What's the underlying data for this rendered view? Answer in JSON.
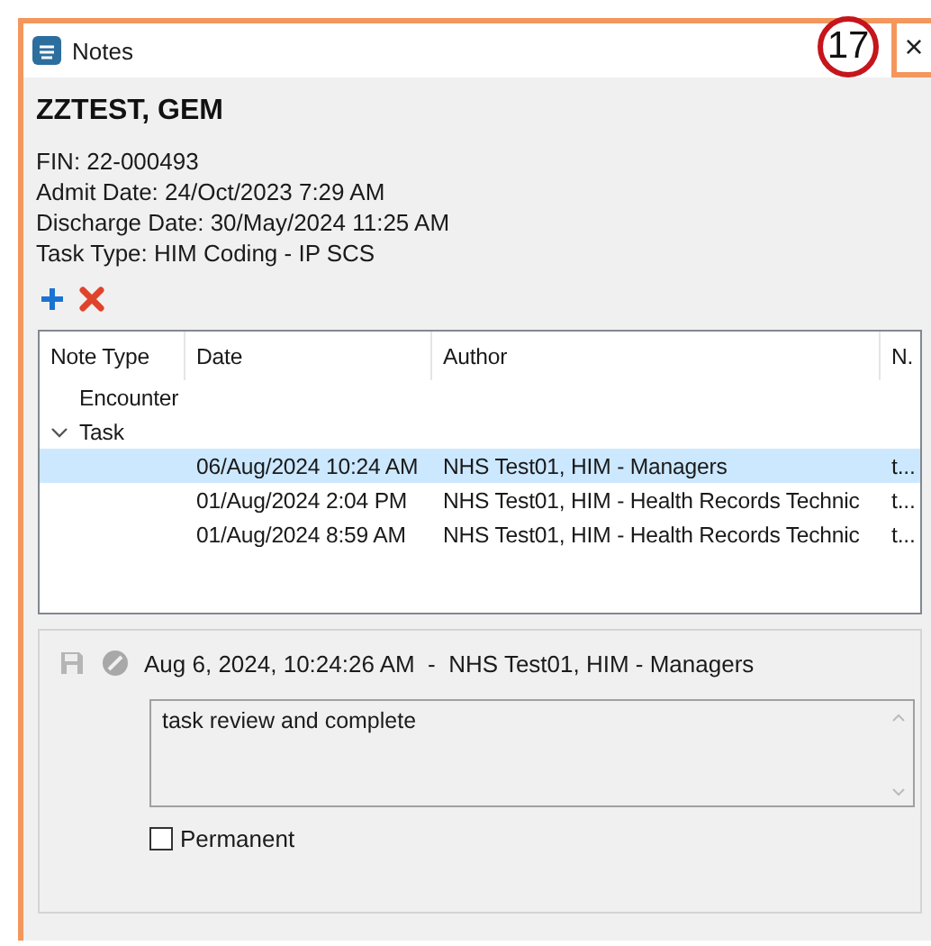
{
  "window": {
    "title": "Notes",
    "close": "×"
  },
  "badge": "17",
  "patient": {
    "name": "ZZTEST, GEM",
    "details": [
      "FIN: 22-000493",
      "Admit Date: 24/Oct/2023 7:29 AM",
      "Discharge Date: 30/May/2024 11:25 AM",
      "Task Type: HIM Coding - IP SCS"
    ]
  },
  "table": {
    "columns": [
      "Note Type",
      "Date",
      "Author",
      "N."
    ],
    "tree": [
      {
        "label": "Encounter"
      },
      {
        "label": "Task",
        "expanded": true,
        "children": [
          {
            "date": "06/Aug/2024 10:24 AM",
            "author": "NHS Test01, HIM - Managers",
            "column_4": "t...",
            "selected": true
          },
          {
            "date": "01/Aug/2024 2:04 PM",
            "author": "NHS Test01, HIM - Health Records Technic",
            "column_4": "t...",
            "selected": false
          },
          {
            "date": "01/Aug/2024 8:59 AM",
            "author": "NHS Test01, HIM - Health Records Technic",
            "column_4": "t...",
            "selected": false
          }
        ]
      }
    ]
  },
  "detail": {
    "header": "Aug 6, 2024, 10:24:26 AM  -  NHS Test01, HIM - Managers",
    "note": "task review and complete",
    "permanent": {
      "label": "Permanent",
      "checked": false
    }
  }
}
